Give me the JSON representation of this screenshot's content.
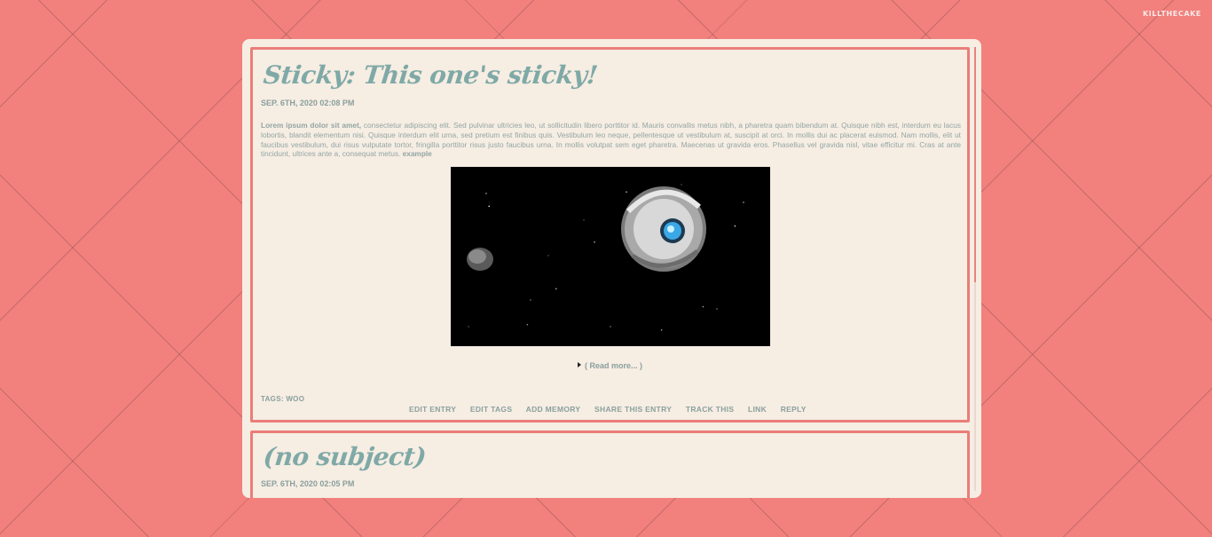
{
  "site": {
    "name": "KILLTHECAKE"
  },
  "entries": [
    {
      "title": "Sticky: This one's sticky!",
      "date": "SEP. 6TH, 2020 02:08 PM",
      "body_bold": "Lorem ipsum dolor sit amet,",
      "body_text": " consectetur adipiscing elit. Sed pulvinar ultricies leo, ut sollicitudin libero porttitor id. Mauris convallis metus nibh, a pharetra quam bibendum at. Quisque nibh est, interdum eu lacus lobortis, blandit elementum nisi. Quisque interdum elit urna, sed pretium est finibus quis. Vestibulum leo neque, pellentesque ut vestibulum at, suscipit at orci. In mollis dui ac placerat euismod. Nam mollis, elit ut faucibus vestibulum, dui risus vulputate tortor, fringilla porttitor risus justo faucibus urna. In mollis volutpat sem eget pharetra. Maecenas ut gravida eros. Phasellus vel gravida nisl, vitae efficitur mi. Cras at ante tincidunt, ultrices ante a, consequat metus.",
      "body_link": "example",
      "read_more": "( Read more... )",
      "tags": "TAGS: WOO",
      "actions": [
        "EDIT ENTRY",
        "EDIT TAGS",
        "ADD MEMORY",
        "SHARE THIS ENTRY",
        "TRACK THIS",
        "LINK",
        "REPLY"
      ]
    },
    {
      "title": "(no subject)",
      "date": "SEP. 6TH, 2020 02:05 PM"
    }
  ],
  "colors": {
    "background": "#f2807d",
    "panel": "#f6ede3",
    "border": "#ea7d78",
    "accent_text": "#7fa9a6"
  },
  "icons": {
    "read_more": "triangle-right-icon"
  }
}
